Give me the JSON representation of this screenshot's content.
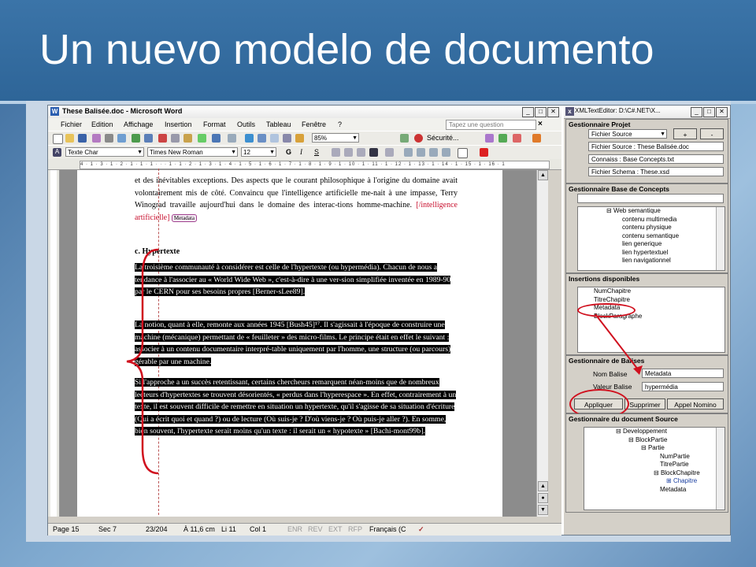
{
  "slide": {
    "title": "Un nuevo modelo de documento"
  },
  "word": {
    "title": "These Balisée.doc - Microsoft Word",
    "menu": [
      "Fichier",
      "Edition",
      "Affichage",
      "Insertion",
      "Format",
      "Outils",
      "Tableau",
      "Fenêtre",
      "?"
    ],
    "ask_placeholder": "Tapez une question",
    "zoom": "85%",
    "security": "Sécurité...",
    "style": "Texte Char",
    "font": "Times New Roman",
    "size": "12",
    "bold": "G",
    "italic": "I",
    "underline": "S",
    "ruler": "4 · 1 · 3 · 1 · 2 · 1 · 1 · 1 · · · 1 · 1 · 2 · 1 · 3 · 1 · 4 · 1 · 5 · 1 · 6 · 1 · 7 · 1 · 8 · 1 · 9 · 1 · 10 · 1 · 11 · 1 · 12 · 1 · 13 · 1 · 14 · 1 · 15 · 1 · 16 · 1",
    "para_a": "et des inévitables exceptions. Des aspects que le courant philosophique à l'origine du domaine avait volontairement mis de côté. Convaincu que l'intelligence artificielle me-nait à une impasse, Terry Winograd travaille aujourd'hui dans le domaine des interac-tions homme-machine.",
    "closing_tag": "[/intelligence artificielle]",
    "metadata_tag": "Metadata",
    "heading": "c. Hypertexte",
    "sel_1": "La troisième communauté à considérer est celle de l'hypertexte (ou hypermédia). Chacun de nous a tendance à l'associer au « World Wide Web », c'est-à-dire à une ver-sion simplifiée inventée en 1989-90 par le CERN pour ses besoins propres [Berner-sLee89].",
    "sel_2": "La notion, quant à elle, remonte aux années 1945 [Bush45]¹⁷. Il s'agissait à l'époque de construire une machine (mécanique) permettant de « feuilleter » des micro-films. Le principe était en effet le suivant : associer à un contenu documentaire interpré-table uniquement par l'homme, une structure (ou parcours) gérable par une machine.",
    "sel_3": "Si l'approche a un succès retentissant, certains chercheurs remarquent néan-moins que de nombreux lecteurs d'hypertextes se trouvent désorientés, « perdus dans l'hyperespace ». En effet, contrairement à un texte, il est souvent difficile de remettre en situation un hypertexte, qu'il s'agisse de sa situation d'écriture (Qui a écrit quoi et quand ?) ou de lecture (Où suis-je ? D'où viens-je ? Où puis-je aller ?). En somme, bien souvent, l'hypertexte serait moins qu'un texte : il serait un « hypotexte » [Bachi-mont99b].",
    "status": {
      "page": "Page 15",
      "sec": "Sec 7",
      "pages": "23/204",
      "pos": "À 11,6 cm",
      "line": "Li 11",
      "col": "Col 1",
      "enr": "ENR",
      "rev": "REV",
      "ext": "EXT",
      "rfp": "RFP",
      "lang": "Français (C"
    }
  },
  "xml": {
    "title": "XMLTextEditor: D:\\C#.NET\\X...",
    "project": {
      "header": "Gestionnaire Projet",
      "selected": "Fichier Source",
      "add": "+",
      "remove": "-",
      "items": [
        "Fichier Source : These Balisée.doc",
        "Connaiss : Base Concepts.txt",
        "Fichier Schema : These.xsd"
      ]
    },
    "concepts": {
      "header": "Gestionnaire Base de Concepts",
      "items": [
        "Web semantique",
        "contenu multimedia",
        "contenu physique",
        "contenu semantique",
        "lien generique",
        "lien hypertextuel",
        "lien navigationnel"
      ]
    },
    "insertions": {
      "header": "Insertions disponibles",
      "items": [
        "NumChapitre",
        "TitreChapitre",
        "Metadata",
        "BlockParagraphe"
      ]
    },
    "tags": {
      "header": "Gestionnaire de Balises",
      "name_label": "Nom Balise",
      "name_value": "Metadata",
      "value_label": "Valeur Balise",
      "value_value": "hypermédia",
      "apply": "Appliquer",
      "delete": "Supprimer",
      "call": "Appel Nomino"
    },
    "source": {
      "header": "Gestionnaire du document Source",
      "items": [
        "Developpement",
        "BlockPartie",
        "Partie",
        "NumPartie",
        "TitrePartie",
        "BlockChapitre",
        "Chapitre",
        "Metadata"
      ]
    }
  }
}
